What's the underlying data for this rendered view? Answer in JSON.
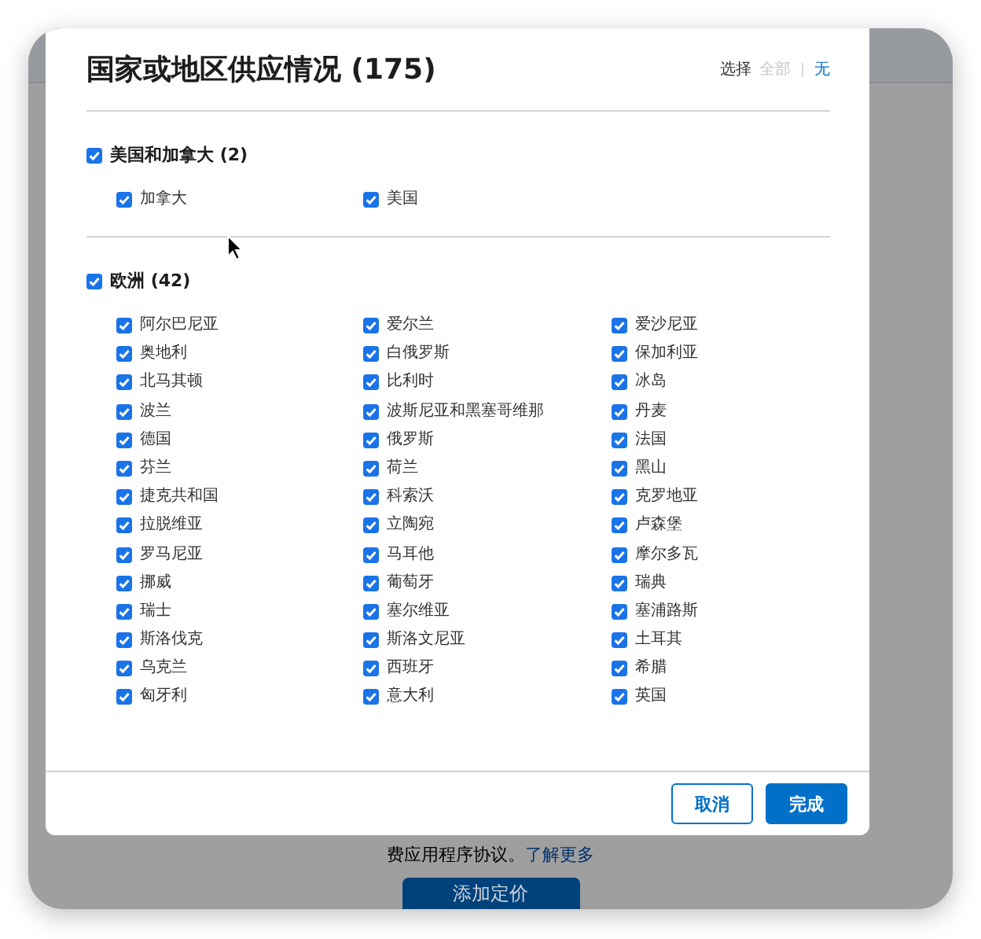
{
  "dialog": {
    "title": "国家或地区供应情况 (175)",
    "select": {
      "label": "选择",
      "all": {
        "text": "全部",
        "disabled": true
      },
      "none": {
        "text": "无",
        "disabled": false
      }
    },
    "groups": [
      {
        "label": "美国和加拿大 (2)",
        "checked": true,
        "items": [
          {
            "name": "加拿大",
            "checked": true
          },
          {
            "name": "美国",
            "checked": true
          }
        ]
      },
      {
        "label": "欧洲 (42)",
        "checked": true,
        "items": [
          {
            "name": "阿尔巴尼亚",
            "checked": true
          },
          {
            "name": "爱尔兰",
            "checked": true
          },
          {
            "name": "爱沙尼亚",
            "checked": true
          },
          {
            "name": "奥地利",
            "checked": true
          },
          {
            "name": "白俄罗斯",
            "checked": true
          },
          {
            "name": "保加利亚",
            "checked": true
          },
          {
            "name": "北马其顿",
            "checked": true
          },
          {
            "name": "比利时",
            "checked": true
          },
          {
            "name": "冰岛",
            "checked": true
          },
          {
            "name": "波兰",
            "checked": true
          },
          {
            "name": "波斯尼亚和黑塞哥维那",
            "checked": true
          },
          {
            "name": "丹麦",
            "checked": true
          },
          {
            "name": "德国",
            "checked": true
          },
          {
            "name": "俄罗斯",
            "checked": true
          },
          {
            "name": "法国",
            "checked": true
          },
          {
            "name": "芬兰",
            "checked": true
          },
          {
            "name": "荷兰",
            "checked": true
          },
          {
            "name": "黑山",
            "checked": true
          },
          {
            "name": "捷克共和国",
            "checked": true
          },
          {
            "name": "科索沃",
            "checked": true
          },
          {
            "name": "克罗地亚",
            "checked": true
          },
          {
            "name": "拉脱维亚",
            "checked": true
          },
          {
            "name": "立陶宛",
            "checked": true
          },
          {
            "name": "卢森堡",
            "checked": true
          },
          {
            "name": "罗马尼亚",
            "checked": true
          },
          {
            "name": "马耳他",
            "checked": true
          },
          {
            "name": "摩尔多瓦",
            "checked": true
          },
          {
            "name": "挪威",
            "checked": true
          },
          {
            "name": "葡萄牙",
            "checked": true
          },
          {
            "name": "瑞典",
            "checked": true
          },
          {
            "name": "瑞士",
            "checked": true
          },
          {
            "name": "塞尔维亚",
            "checked": true
          },
          {
            "name": "塞浦路斯",
            "checked": true
          },
          {
            "name": "斯洛伐克",
            "checked": true
          },
          {
            "name": "斯洛文尼亚",
            "checked": true
          },
          {
            "name": "土耳其",
            "checked": true
          },
          {
            "name": "乌克兰",
            "checked": true
          },
          {
            "name": "西班牙",
            "checked": true
          },
          {
            "name": "希腊",
            "checked": true
          },
          {
            "name": "匈牙利",
            "checked": true
          },
          {
            "name": "意大利",
            "checked": true
          },
          {
            "name": "英国",
            "checked": true
          }
        ]
      }
    ],
    "buttons": [
      {
        "label": "取消",
        "kind": "secondary"
      },
      {
        "label": "完成",
        "kind": "primary"
      }
    ]
  },
  "background": {
    "note": "费应用程序协议。",
    "link": "了解更多",
    "button": "添加定价"
  }
}
